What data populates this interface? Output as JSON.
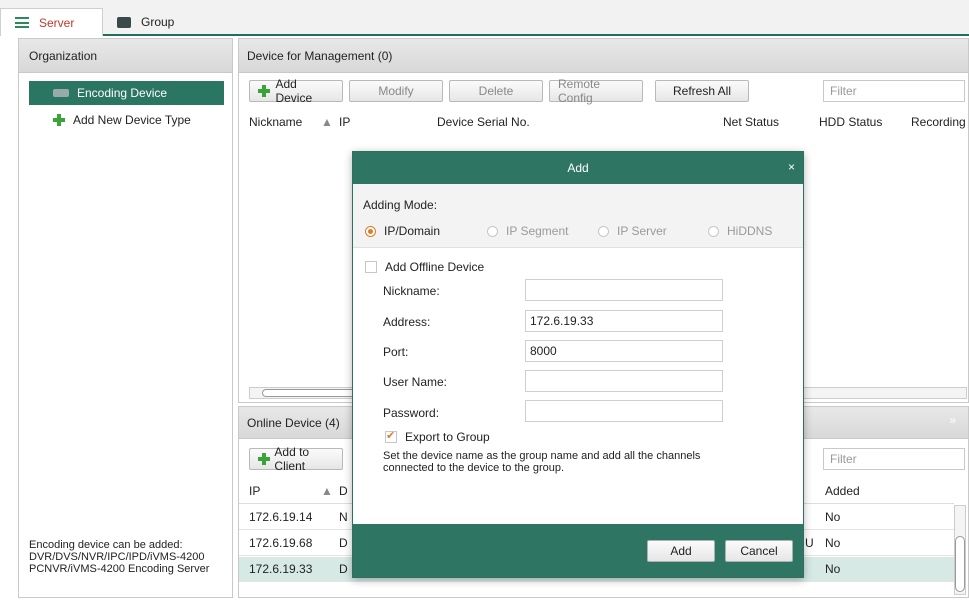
{
  "tabs": [
    {
      "label": "Server",
      "active": true
    },
    {
      "label": "Group",
      "active": false
    }
  ],
  "org": {
    "title": "Organization",
    "selected_item": "Encoding Device",
    "item": "Add New Device Type",
    "footer": [
      "Encoding device can be added:",
      "DVR/DVS/NVR/IPC/IPD/iVMS-4200",
      "PCNVR/iVMS-4200 Encoding Server"
    ]
  },
  "mgmt": {
    "title": "Device for Management (0)",
    "buttons": {
      "add": "Add Device",
      "modify": "Modify",
      "delete": "Delete",
      "remote": "Remote Config",
      "refresh": "Refresh All"
    },
    "filter_placeholder": "Filter",
    "columns": [
      "Nickname",
      "IP",
      "Device Serial No.",
      "Net Status",
      "HDD Status",
      "Recording"
    ]
  },
  "online": {
    "title": "Online Device (4)",
    "add_button": "Add to Client",
    "filter_placeholder": "Filter",
    "columns": {
      "ip": "IP",
      "d": "D",
      "added": "Added"
    },
    "rows": [
      {
        "ip": "172.6.19.14",
        "d": "N",
        "u": "",
        "added": "No"
      },
      {
        "ip": "172.6.19.68",
        "d": "D",
        "u": "U",
        "added": "No"
      },
      {
        "ip": "172.6.19.33",
        "d": "D",
        "u": "",
        "added": "No"
      }
    ]
  },
  "modal": {
    "title": "Add",
    "close": "×",
    "adding_mode_label": "Adding Mode:",
    "modes": [
      "IP/Domain",
      "IP Segment",
      "IP Server",
      "HiDDNS"
    ],
    "offline_label": "Add Offline Device",
    "fields": {
      "nickname": {
        "label": "Nickname:",
        "value": ""
      },
      "address": {
        "label": "Address:",
        "value": "172.6.19.33"
      },
      "port": {
        "label": "Port:",
        "value": "8000"
      },
      "username": {
        "label": "User Name:",
        "value": ""
      },
      "password": {
        "label": "Password:",
        "value": ""
      }
    },
    "export_label": "Export to Group",
    "hint": "Set the device name as the group name and add all the channels connected to the device to the group.",
    "ok": "Add",
    "cancel": "Cancel"
  },
  "colors": {
    "accent": "#2f7563",
    "radio": "#e07b2b",
    "tab_active_text": "#c0392b"
  }
}
